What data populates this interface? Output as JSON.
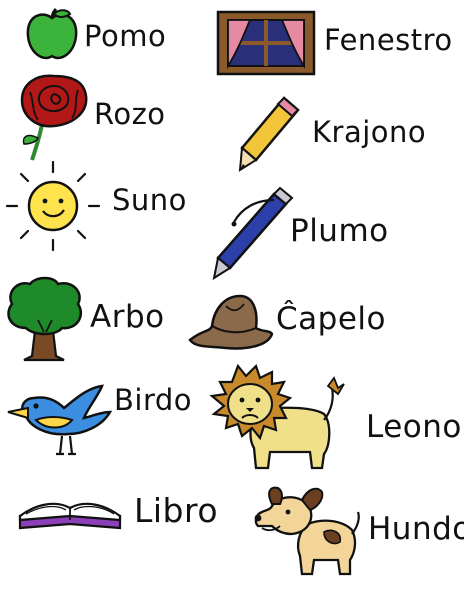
{
  "words": {
    "pomo": "Pomo",
    "rozo": "Rozo",
    "suno": "Suno",
    "arbo": "Arbo",
    "birdo": "Birdo",
    "libro": "Libro",
    "fenestro": "Fenestro",
    "krajono": "Krajono",
    "plumo": "Plumo",
    "capelo": "Ĉapelo",
    "leono": "Leono",
    "hundo": "Hundo"
  },
  "icons": [
    "apple-icon",
    "rose-icon",
    "sun-icon",
    "tree-icon",
    "bird-icon",
    "book-icon",
    "window-icon",
    "pencil-icon",
    "pen-icon",
    "hat-icon",
    "lion-icon",
    "dog-icon"
  ],
  "colors": {
    "ink": "#111111",
    "apple": "#3cb43c",
    "rose": "#b21818",
    "sun": "#ffe34d",
    "tree-leaves": "#1f8a2a",
    "tree-trunk": "#7a4a26",
    "bird": "#3c8fe0",
    "book": "#8b3fb8",
    "window-frame": "#8b5a2b",
    "curtain": "#e58aa3",
    "pencil": "#f2c53a",
    "pen": "#2d3fa8",
    "hat": "#8a6a4a",
    "lion": "#f0e08a",
    "mane": "#c88a2a",
    "dog": "#f3d59a"
  }
}
